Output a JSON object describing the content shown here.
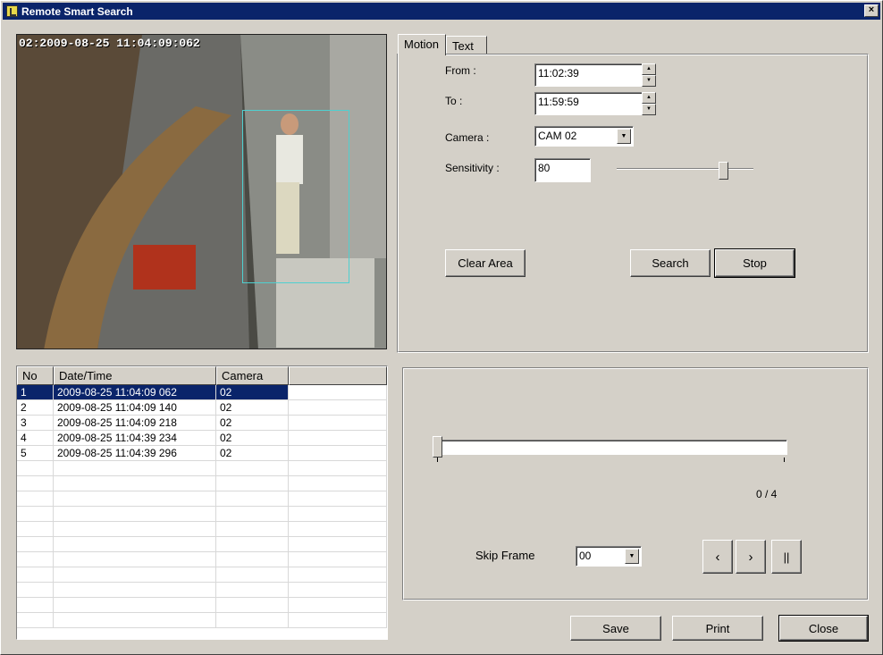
{
  "window": {
    "title": "Remote Smart Search",
    "close_label": "×"
  },
  "video": {
    "timestamp": "02:2009-08-25 11:04:09:062"
  },
  "tabs": [
    {
      "label": "Motion"
    },
    {
      "label": "Text"
    }
  ],
  "motion": {
    "from_label": "From :",
    "from_value": "11:02:39",
    "to_label": "To :",
    "to_value": "11:59:59",
    "camera_label": "Camera :",
    "camera_value": "CAM 02",
    "sensitivity_label": "Sensitivity :",
    "sensitivity_value": "80",
    "sensitivity_level": 0.8,
    "clear_area": "Clear Area",
    "search": "Search",
    "stop": "Stop"
  },
  "results": {
    "columns": [
      "No",
      "Date/Time",
      "Camera"
    ],
    "rows": [
      {
        "no": "1",
        "datetime": "2009-08-25 11:04:09 062",
        "camera": "02"
      },
      {
        "no": "2",
        "datetime": "2009-08-25 11:04:09 140",
        "camera": "02"
      },
      {
        "no": "3",
        "datetime": "2009-08-25 11:04:09 218",
        "camera": "02"
      },
      {
        "no": "4",
        "datetime": "2009-08-25 11:04:39 234",
        "camera": "02"
      },
      {
        "no": "5",
        "datetime": "2009-08-25 11:04:39 296",
        "camera": "02"
      }
    ]
  },
  "playback": {
    "position": "0 / 4",
    "skip_frame_label": "Skip Frame",
    "skip_frame_value": "00",
    "prev": "‹",
    "next": "›",
    "pause": "||"
  },
  "footer": {
    "save": "Save",
    "print": "Print",
    "close": "Close"
  }
}
